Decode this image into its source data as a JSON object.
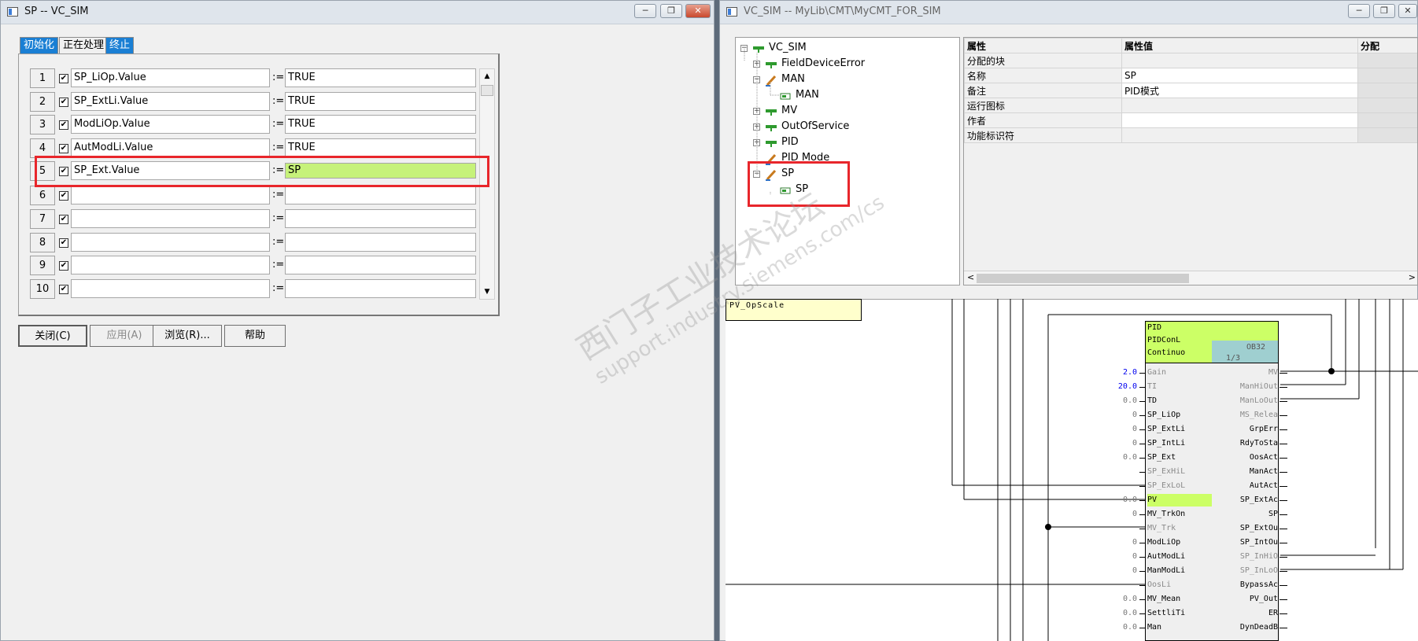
{
  "left_window": {
    "title": "SP -- VC_SIM",
    "tabs": [
      "初始化",
      "正在处理",
      "终止"
    ],
    "rows": [
      {
        "num": "1",
        "left": "SP_LiOp.Value",
        "op": ":=",
        "right": "TRUE"
      },
      {
        "num": "2",
        "left": "SP_ExtLi.Value",
        "op": ":=",
        "right": "TRUE"
      },
      {
        "num": "3",
        "left": "ModLiOp.Value",
        "op": ":=",
        "right": "TRUE"
      },
      {
        "num": "4",
        "left": "AutModLi.Value",
        "op": ":=",
        "right": "TRUE"
      },
      {
        "num": "5",
        "left": "SP_Ext.Value",
        "op": ":=",
        "right": "SP"
      },
      {
        "num": "6",
        "left": "",
        "op": ":=",
        "right": ""
      },
      {
        "num": "7",
        "left": "",
        "op": ":=",
        "right": ""
      },
      {
        "num": "8",
        "left": "",
        "op": ":=",
        "right": ""
      },
      {
        "num": "9",
        "left": "",
        "op": ":=",
        "right": ""
      },
      {
        "num": "10",
        "left": "",
        "op": ":=",
        "right": ""
      }
    ],
    "buttons": {
      "close": "关闭(C)",
      "apply": "应用(A)",
      "browse": "浏览(R)...",
      "help": "帮助"
    }
  },
  "right_window": {
    "title": "VC_SIM -- MyLib\\CMT\\MyCMT_FOR_SIM",
    "tree": [
      {
        "label": "VC_SIM"
      },
      {
        "label": "FieldDeviceError"
      },
      {
        "label": "MAN"
      },
      {
        "label": "MAN"
      },
      {
        "label": "MV"
      },
      {
        "label": "OutOfService"
      },
      {
        "label": "PID"
      },
      {
        "label": "PID Mode"
      },
      {
        "label": "SP"
      },
      {
        "label": "SP"
      }
    ],
    "props": {
      "headers": [
        "属性",
        "属性值",
        "分配"
      ],
      "rows": [
        {
          "name": "分配的块",
          "value": ""
        },
        {
          "name": "名称",
          "value": "SP"
        },
        {
          "name": "备注",
          "value": "PID模式"
        },
        {
          "name": "运行图标",
          "value": ""
        },
        {
          "name": "作者",
          "value": ""
        },
        {
          "name": "功能标识符",
          "value": ""
        }
      ]
    },
    "cfc": {
      "note": "PV_OpScale",
      "block": {
        "name": "PID",
        "type": "PIDConL",
        "mode": "Continuo",
        "ob": "OB32",
        "seq": "1/3"
      },
      "inputs": [
        {
          "pin": "Gain",
          "val": "2.0"
        },
        {
          "pin": "TI",
          "val": "20.0"
        },
        {
          "pin": "TD",
          "val": "0.0"
        },
        {
          "pin": "SP_LiOp",
          "val": "0"
        },
        {
          "pin": "SP_ExtLi",
          "val": "0"
        },
        {
          "pin": "SP_IntLi",
          "val": "0"
        },
        {
          "pin": "SP_Ext",
          "val": "0.0"
        },
        {
          "pin": "SP_ExHiL",
          "val": ""
        },
        {
          "pin": "SP_ExLoL",
          "val": ""
        },
        {
          "pin": "PV",
          "val": "0.0"
        },
        {
          "pin": "MV_TrkOn",
          "val": "0"
        },
        {
          "pin": "MV_Trk",
          "val": ""
        },
        {
          "pin": "ModLiOp",
          "val": "0"
        },
        {
          "pin": "AutModLi",
          "val": "0"
        },
        {
          "pin": "ManModLi",
          "val": "0"
        },
        {
          "pin": "OosLi",
          "val": ""
        },
        {
          "pin": "MV_Mean",
          "val": "0.0"
        },
        {
          "pin": "SettliTi",
          "val": "0.0"
        },
        {
          "pin": "Man",
          "val": "0.0"
        }
      ],
      "outputs": [
        "MV",
        "ManHiOut",
        "ManLoOut",
        "MS_Relea",
        "GrpErr",
        "RdyToSta",
        "OosAct",
        "ManAct",
        "AutAct",
        "SP_ExtAc",
        "SP",
        "SP_ExtOu",
        "SP_IntOu",
        "SP_InHiO",
        "SP_InLoO",
        "BypassAc",
        "PV_Out",
        "ER",
        "DynDeadB"
      ]
    },
    "watermark": {
      "cn": "西门子工业技术论坛",
      "en": "support.industry.siemens.com/cs"
    }
  },
  "colors": {
    "highlight_red": "#e8262b",
    "green_field": "#c6f27a",
    "tab_blue": "#1a7fd4",
    "block_green": "#ccff66"
  }
}
